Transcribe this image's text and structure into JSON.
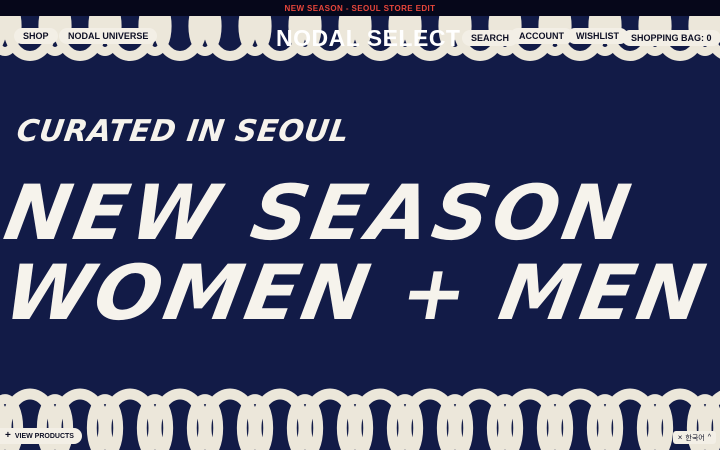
{
  "announcement": {
    "text": "NEW SEASON - SEOUL STORE EDIT"
  },
  "header": {
    "left_nav": [
      {
        "label": "SHOP"
      },
      {
        "label": "NODAL UNIVERSE"
      }
    ],
    "logo": "NODAL SELECT",
    "right_nav": [
      {
        "label": "SEARCH"
      },
      {
        "label": "ACCOUNT"
      },
      {
        "label": "WISHLIST"
      },
      {
        "label": "SHOPPING BAG: 0"
      }
    ]
  },
  "hero": {
    "kicker": "CURATED IN SEOUL",
    "headline_line1": "NEW SEASON",
    "headline_line2": "WOMEN + MEN"
  },
  "footer": {
    "view_products": {
      "icon": "plus-icon",
      "label": "VIEW PRODUCTS"
    },
    "language": {
      "close_icon": "close-icon",
      "label": "한국어",
      "chevron_icon": "chevron-up-icon"
    }
  },
  "colors": {
    "background": "#121b47",
    "chain": "#ece7da",
    "announcement_bg": "#06071a",
    "announcement_text": "#e8463b",
    "pill_bg": "#f3efe6"
  }
}
